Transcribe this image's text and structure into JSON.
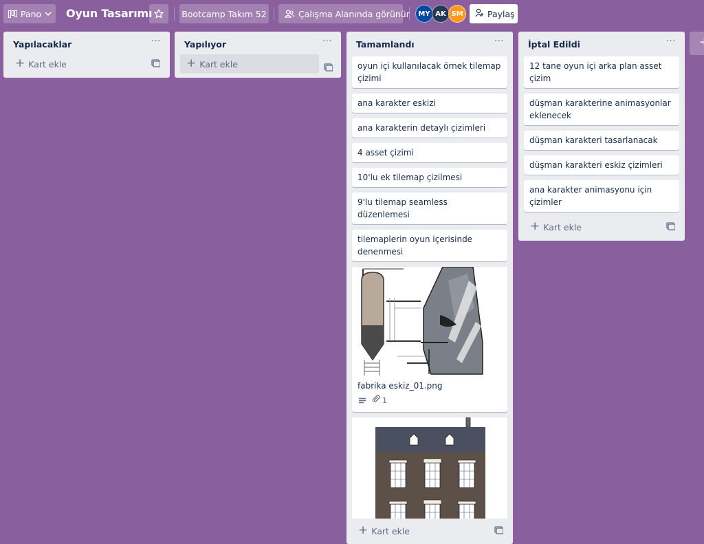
{
  "header": {
    "view_switch_label": "Pano",
    "board_title": "Oyun Tasarımı",
    "workspace_label": "Bootcamp Takım 52",
    "visibility_label": "Çalışma Alanında görünür",
    "share_label": "Paylaş",
    "members": [
      {
        "initials": "MY",
        "color": "#0747a6"
      },
      {
        "initials": "AK",
        "color": "#253858"
      },
      {
        "initials": "SM",
        "color": "#ff991f"
      }
    ]
  },
  "colors": {
    "board_bg": "#8a5f9e",
    "list_bg": "#ebecf0",
    "card_bg": "#ffffff"
  },
  "lists": [
    {
      "title": "Yapılacaklar",
      "menu": "···",
      "add_card_label": "Kart ekle",
      "cards": []
    },
    {
      "title": "Yapılıyor",
      "menu": "···",
      "add_card_label": "Kart ekle",
      "cards": []
    },
    {
      "title": "Tamamlandı",
      "menu": "···",
      "add_card_label": "Kart ekle",
      "cards": [
        "oyun içi kullanılacak örnek tilemap çizimi",
        "ana karakter eskizi",
        "ana karakterin detaylı çizimleri",
        "4 asset çizimi",
        "10'lu ek tilemap çizilmesi",
        "9'lu tilemap seamless düzenlemesi",
        "tilemaplerin oyun içerisinde denenmesi"
      ],
      "image_cards": [
        {
          "title": "fabrika eskiz_01.png",
          "cover": "factory-sketch-image",
          "has_description": true,
          "attachments": "1"
        },
        {
          "title": "",
          "cover": "building-sketch-image"
        }
      ]
    },
    {
      "title": "İptal Edildi",
      "menu": "···",
      "add_card_label": "Kart ekle",
      "cards": [
        "12 tane oyun içi arka plan asset çizim",
        "düşman karakterine animasyonlar eklenecek",
        "düşman karakteri tasarlanacak",
        "düşman karakteri eskiz çizimleri",
        "ana karakter animasyonu için çizimler"
      ]
    }
  ],
  "add_list_label": "+"
}
